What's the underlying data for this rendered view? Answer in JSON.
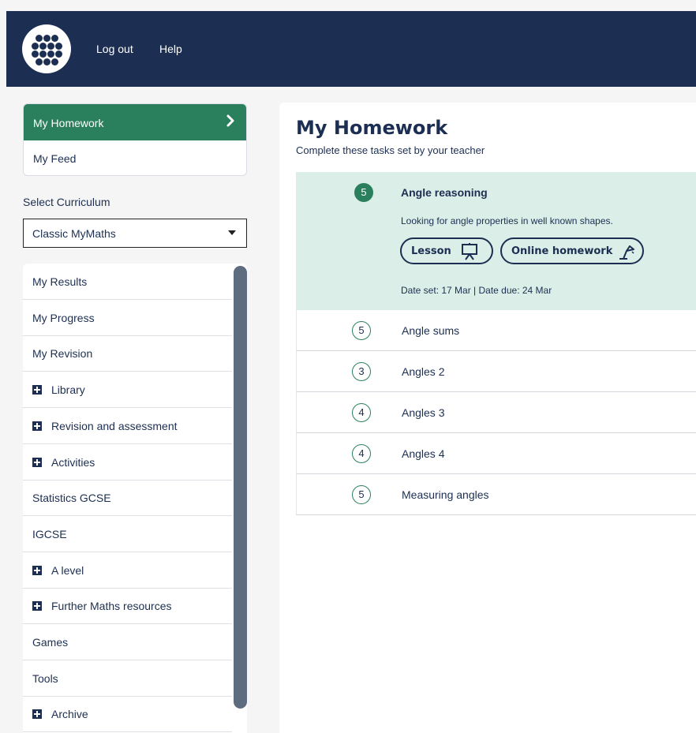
{
  "header": {
    "logout_label": "Log out",
    "help_label": "Help"
  },
  "nav": {
    "my_homework": "My Homework",
    "my_feed": "My Feed"
  },
  "curriculum": {
    "label": "Select Curriculum",
    "selected": "Classic MyMaths"
  },
  "menu": {
    "items": [
      {
        "label": "My Results",
        "expandable": false
      },
      {
        "label": "My Progress",
        "expandable": false
      },
      {
        "label": "My Revision",
        "expandable": false
      },
      {
        "label": "Library",
        "expandable": true
      },
      {
        "label": "Revision and assessment",
        "expandable": true
      },
      {
        "label": "Activities",
        "expandable": true
      },
      {
        "label": "Statistics GCSE",
        "expandable": false
      },
      {
        "label": "IGCSE",
        "expandable": false
      },
      {
        "label": "A level",
        "expandable": true
      },
      {
        "label": "Further Maths resources",
        "expandable": true
      },
      {
        "label": "Games",
        "expandable": false
      },
      {
        "label": "Tools",
        "expandable": false
      },
      {
        "label": "Archive",
        "expandable": true
      }
    ]
  },
  "main": {
    "title": "My Homework",
    "subtitle": "Complete these tasks set by your teacher",
    "active_task": {
      "level": "5",
      "title": "Angle reasoning",
      "description": "Looking for angle properties in well known shapes.",
      "lesson_label": "Lesson",
      "online_homework_label": "Online homework",
      "dates": "Date set: 17 Mar | Date due: 24 Mar"
    },
    "tasks": [
      {
        "level": "5",
        "title": "Angle sums"
      },
      {
        "level": "3",
        "title": "Angles 2"
      },
      {
        "level": "4",
        "title": "Angles 3"
      },
      {
        "level": "4",
        "title": "Angles 4"
      },
      {
        "level": "5",
        "title": "Measuring angles"
      }
    ]
  },
  "colors": {
    "header_bg": "#1c2f52",
    "accent_green": "#2a7f5c",
    "active_row_bg": "#dbeee8"
  },
  "icons": {
    "logo": "dots-grid-logo",
    "nav_chevron": "chevron-right-icon",
    "expand": "plus-square-icon",
    "lesson": "presentation-board-icon",
    "homework": "desk-lamp-icon"
  }
}
